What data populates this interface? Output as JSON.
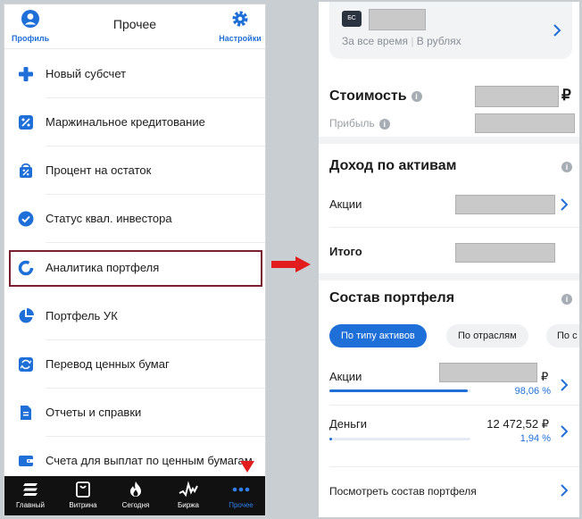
{
  "left": {
    "header": {
      "title": "Прочее",
      "profile_label": "Профиль",
      "settings_label": "Настройки"
    },
    "menu": [
      {
        "icon": "plus-icon",
        "label": "Новый субсчет"
      },
      {
        "icon": "percent-icon",
        "label": "Маржинальное кредитование"
      },
      {
        "icon": "bag-percent-icon",
        "label": "Процент на остаток"
      },
      {
        "icon": "check-circle-icon",
        "label": "Статус квал. инвестора"
      },
      {
        "icon": "donut-chart-icon",
        "label": "Аналитика портфеля"
      },
      {
        "icon": "pie-chart-icon",
        "label": "Портфель УК"
      },
      {
        "icon": "transfer-icon",
        "label": "Перевод ценных бумаг"
      },
      {
        "icon": "document-icon",
        "label": "Отчеты и справки"
      },
      {
        "icon": "wallet-icon",
        "label": "Счета для выплат по ценным бумагам"
      }
    ],
    "tabs": [
      {
        "icon": "stack-icon",
        "label": "Главный"
      },
      {
        "icon": "shop-bag-icon",
        "label": "Витрина"
      },
      {
        "icon": "flame-icon",
        "label": "Сегодня"
      },
      {
        "icon": "pulse-icon",
        "label": "Биржа"
      },
      {
        "icon": "more-dots-icon",
        "label": "Прочее"
      }
    ],
    "accent": "#1f6fd8",
    "highlight_color": "#7a1f2f"
  },
  "right": {
    "account": {
      "badge": "БС",
      "period": "За все время",
      "currency": "В рублях"
    },
    "value": {
      "title": "Стоимость",
      "profit_label": "Прибыль",
      "currency_sign": "₽"
    },
    "income": {
      "title": "Доход по активам",
      "rows": [
        {
          "label": "Акции"
        }
      ],
      "total_label": "Итого"
    },
    "portfolio": {
      "title": "Состав портфеля",
      "chips": [
        "По типу активов",
        "По отраслям",
        "По с"
      ],
      "rows": [
        {
          "label": "Акции",
          "amount": "",
          "currency": "₽",
          "percent": "98,06 %",
          "share": 98.06
        },
        {
          "label": "Деньги",
          "amount": "12 472,52 ₽",
          "currency": "",
          "percent": "1,94 %",
          "share": 1.94
        }
      ],
      "view_all": "Посмотреть состав портфеля"
    }
  }
}
